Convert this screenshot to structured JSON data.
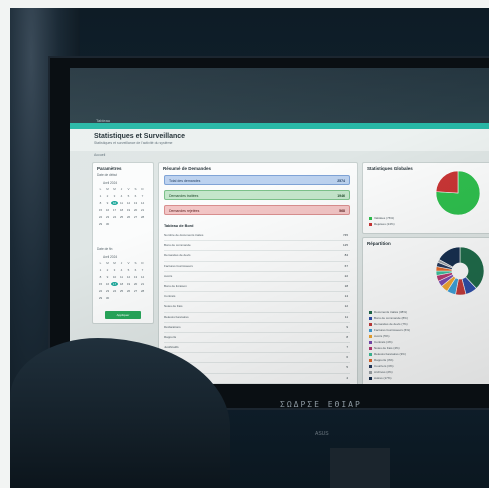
{
  "app": {
    "topbar_tab": "Tableau",
    "title": "Statistiques et Surveillance",
    "subtitle": "Statistiques et surveillance de l'activité du système",
    "breadcrumb": "Accueil"
  },
  "calendar_panel": {
    "title": "Paramètres",
    "first_label": "Date de début",
    "first_month": "Avril 2024",
    "first_days": [
      "L",
      "M",
      "M",
      "J",
      "V",
      "S",
      "D",
      "1",
      "2",
      "3",
      "4",
      "5",
      "6",
      "7",
      "8",
      "9",
      "10",
      "11",
      "12",
      "13",
      "14",
      "15",
      "16",
      "17",
      "18",
      "19",
      "20",
      "21",
      "22",
      "23",
      "24",
      "25",
      "26",
      "27",
      "28",
      "29",
      "30"
    ],
    "first_selected": "10",
    "second_label": "Date de fin",
    "second_month": "Avril 2024",
    "second_days": [
      "L",
      "M",
      "M",
      "J",
      "V",
      "S",
      "D",
      "1",
      "2",
      "3",
      "4",
      "5",
      "6",
      "7",
      "8",
      "9",
      "10",
      "11",
      "12",
      "13",
      "14",
      "15",
      "16",
      "17",
      "18",
      "19",
      "20",
      "21",
      "22",
      "23",
      "24",
      "25",
      "26",
      "27",
      "28",
      "29",
      "30"
    ],
    "second_selected": "17",
    "apply_button": "Appliquer"
  },
  "summary": {
    "title": "Résumé de Demandes",
    "stats": [
      {
        "label": "Total des demandes",
        "value": "2574",
        "tone": "blue"
      },
      {
        "label": "Demandes traitées",
        "value": "1946",
        "tone": "green"
      },
      {
        "label": "Demandes rejetées",
        "value": "568",
        "tone": "red"
      }
    ],
    "table_title": "Tableau de Bord",
    "rows": [
      {
        "label": "Nombre de documents traités",
        "value": "745"
      },
      {
        "label": "Bons de commande",
        "value": "125"
      },
      {
        "label": "Demandes de devis",
        "value": "84"
      },
      {
        "label": "Factures fournisseurs",
        "value": "67"
      },
      {
        "label": "Avoirs",
        "value": "22"
      },
      {
        "label": "Bons de livraison",
        "value": "18"
      },
      {
        "label": "Contrats",
        "value": "14"
      },
      {
        "label": "Notes de frais",
        "value": "12"
      },
      {
        "label": "Relevés bancaires",
        "value": "11"
      },
      {
        "label": "Déclarations",
        "value": "9"
      },
      {
        "label": "Rapports",
        "value": "8"
      },
      {
        "label": "Justificatifs",
        "value": "7"
      },
      {
        "label": "Courriers",
        "value": "6"
      },
      {
        "label": "Mandats",
        "value": "5"
      },
      {
        "label": "Autres documents",
        "value": "4"
      },
      {
        "label": "Pièces jointes",
        "value": "3"
      },
      {
        "label": "Archives",
        "value": "2"
      },
      {
        "label": "Total documents",
        "value": "1142"
      }
    ]
  },
  "pie_top": {
    "title": "Statistiques Globales",
    "legend": [
      "Validées (76%)",
      "Rejetées (24%)"
    ]
  },
  "pie_bottom": {
    "title": "Répartition",
    "legend": [
      "Documents traités (38%)",
      "Bons de commande (8%)",
      "Demandes de devis (7%)",
      "Factures fournisseurs (6%)",
      "Avoirs (5%)",
      "Contrats (4%)",
      "Notes de frais (4%)",
      "Relevés bancaires (3%)",
      "Rapports (3%)",
      "Courriers (3%)",
      "Archives (2%)",
      "Autres (17%)"
    ]
  },
  "monitor": {
    "bezel_label": "ΣΩΔΡΣΕ ΕΘΙΑΡ",
    "brand": "ASUS"
  },
  "colors": {
    "teal": "#27b8a6",
    "green": "#27a65a",
    "red": "#c93535",
    "navy": "#1f3f6e"
  },
  "chart_data": [
    {
      "type": "pie",
      "title": "",
      "labels": [
        "Validées",
        "Rejetées"
      ],
      "values": [
        76,
        24
      ],
      "colors": [
        "#2fbf4e",
        "#c93535"
      ]
    },
    {
      "type": "pie",
      "title": "",
      "labels": [
        "Documents traités",
        "Bons de commande",
        "Demandes de devis",
        "Factures fournisseurs",
        "Avoirs",
        "Contrats",
        "Notes de frais",
        "Relevés bancaires",
        "Rapports",
        "Courriers",
        "Archives",
        "Autres"
      ],
      "values": [
        38,
        8,
        7,
        6,
        5,
        4,
        4,
        3,
        3,
        3,
        2,
        17
      ],
      "colors": [
        "#1f6b4a",
        "#2f4fa8",
        "#c23b3b",
        "#3fa0d8",
        "#f0a733",
        "#7a4bb3",
        "#b73a72",
        "#3fbf9b",
        "#e26a2c",
        "#263b5e",
        "#a0a6ab",
        "#173050"
      ]
    }
  ]
}
